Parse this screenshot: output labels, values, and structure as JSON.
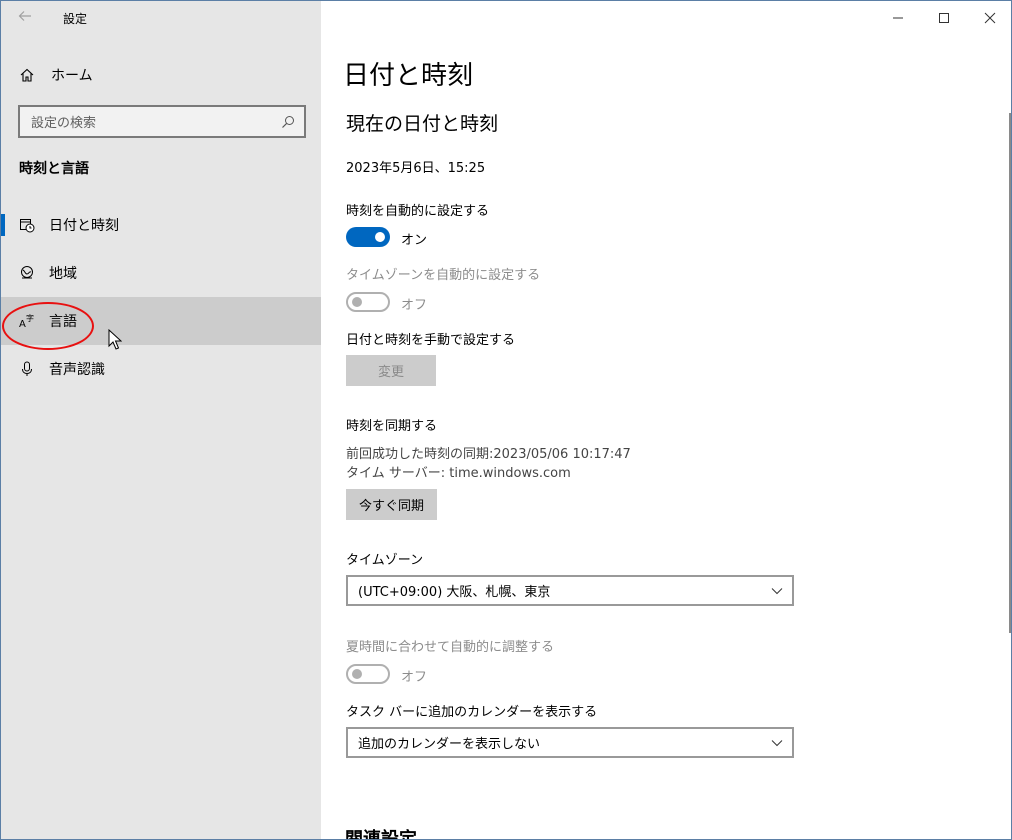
{
  "window": {
    "title": "設定"
  },
  "sidebar": {
    "home_label": "ホーム",
    "search_placeholder": "設定の検索",
    "section_title": "時刻と言語",
    "items": [
      {
        "label": "日付と時刻",
        "icon": "date-time-icon",
        "state": "selected"
      },
      {
        "label": "地域",
        "icon": "globe-icon",
        "state": "normal"
      },
      {
        "label": "言語",
        "icon": "language-icon",
        "state": "hover"
      },
      {
        "label": "音声認識",
        "icon": "microphone-icon",
        "state": "normal"
      }
    ]
  },
  "content": {
    "page_title": "日付と時刻",
    "current_section": "現在の日付と時刻",
    "current_datetime": "2023年5月6日、15:25",
    "auto_time": {
      "label": "時刻を自動的に設定する",
      "state_text": "オン",
      "on": true
    },
    "auto_timezone": {
      "label": "タイムゾーンを自動的に設定する",
      "state_text": "オフ",
      "on": false,
      "disabled": true
    },
    "manual": {
      "label": "日付と時刻を手動で設定する",
      "button": "変更"
    },
    "sync": {
      "title": "時刻を同期する",
      "last_sync": "前回成功した時刻の同期:2023/05/06 10:17:47",
      "server": "タイム サーバー: time.windows.com",
      "button": "今すぐ同期"
    },
    "timezone": {
      "label": "タイムゾーン",
      "value": "(UTC+09:00) 大阪、札幌、東京"
    },
    "dst": {
      "label": "夏時間に合わせて自動的に調整する",
      "state_text": "オフ",
      "on": false,
      "disabled": true
    },
    "calendar": {
      "label": "タスク バーに追加のカレンダーを表示する",
      "value": "追加のカレンダーを表示しない"
    },
    "related_title": "関連設定"
  },
  "colors": {
    "accent": "#0067c0",
    "annotation": "#e81010",
    "sidebar_bg": "#e6e6e6",
    "hover_bg": "#cccccc"
  }
}
